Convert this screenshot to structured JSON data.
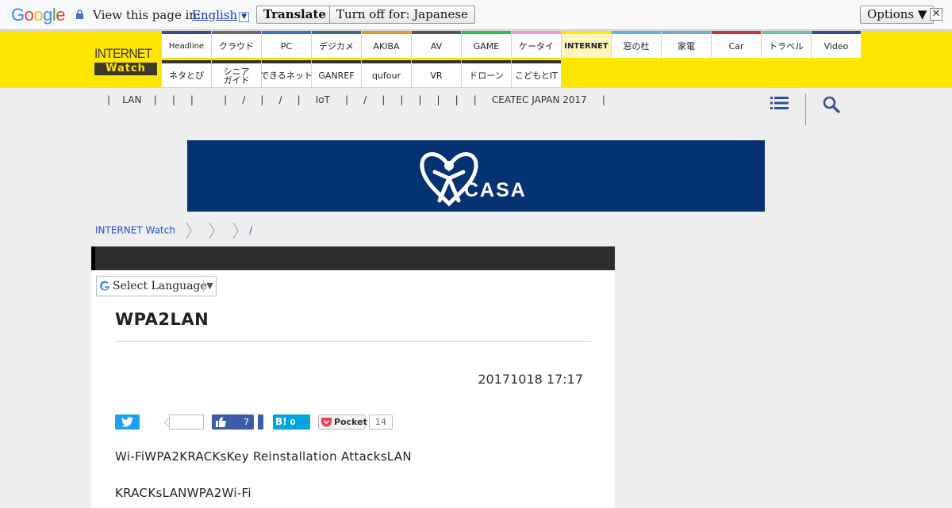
{
  "translate_bar": {
    "logo": "Google",
    "prompt": "View this page in:",
    "language": "English",
    "translate_label": "Translate",
    "turn_off_label": "Turn off for: Japanese",
    "options_label": "Options ▼",
    "close_glyph": "✕"
  },
  "site": {
    "logo_top": "INTERNET",
    "logo_bottom": "Watch"
  },
  "nav": {
    "row1": [
      {
        "label": "Headline",
        "color": "#2e4f9e"
      },
      {
        "label": "クラウド",
        "color": "#6b6b6b"
      },
      {
        "label": "PC",
        "color": "#3a6fd0"
      },
      {
        "label": "デジカメ",
        "color": "#3a6f8a"
      },
      {
        "label": "AKIBA",
        "color": "#e59a2a"
      },
      {
        "label": "AV",
        "color": "#555555"
      },
      {
        "label": "GAME",
        "color": "#2bbf5a"
      },
      {
        "label": "ケータイ",
        "color": "#e89acd"
      },
      {
        "label": "INTERNET",
        "color": "#ffe600"
      },
      {
        "label": "窓の杜",
        "color": "#5ab8e0"
      },
      {
        "label": "家電",
        "color": "#76a8d8"
      },
      {
        "label": "Car",
        "color": "#c8323c"
      },
      {
        "label": "トラベル",
        "color": "#6ec2a8"
      },
      {
        "label": "Video",
        "color": "#2e4f9e"
      }
    ],
    "row2": [
      {
        "label": "ネタとぴ",
        "color": "#333333"
      },
      {
        "label": "シニア\nガイド",
        "color": "#333333"
      },
      {
        "label": "できるネット",
        "color": "#333333"
      },
      {
        "label": "GANREF",
        "color": "#333333"
      },
      {
        "label": "qufour",
        "color": "#333333"
      },
      {
        "label": "VR",
        "color": "#333333"
      },
      {
        "label": "ドローン",
        "color": "#333333"
      },
      {
        "label": "こどもとIT",
        "color": "#333333"
      }
    ]
  },
  "subnav": {
    "links": "|    LAN    |     |     |          |     /     |     /     |     IoT     |     /     |     |     |     |     |     |     CEATEC JAPAN 2017     |"
  },
  "breadcrumb": {
    "home": "INTERNET Watch",
    "tail": "/"
  },
  "article": {
    "language_select": "Select Language",
    "title": "WPA2LAN",
    "date": "20171018 17:17",
    "fb_count": "7",
    "hatena_label": "B!",
    "hatena_count": "0",
    "pocket_label": "Pocket",
    "pocket_count": "14",
    "paragraph1": "Wi-FiWPA2KRACKsKey Reinstallation AttacksLAN",
    "paragraph2": "KRACKsLANWPA2Wi-Fi"
  },
  "banner": {
    "brand": "CASA",
    "bg_color": "#053273"
  }
}
